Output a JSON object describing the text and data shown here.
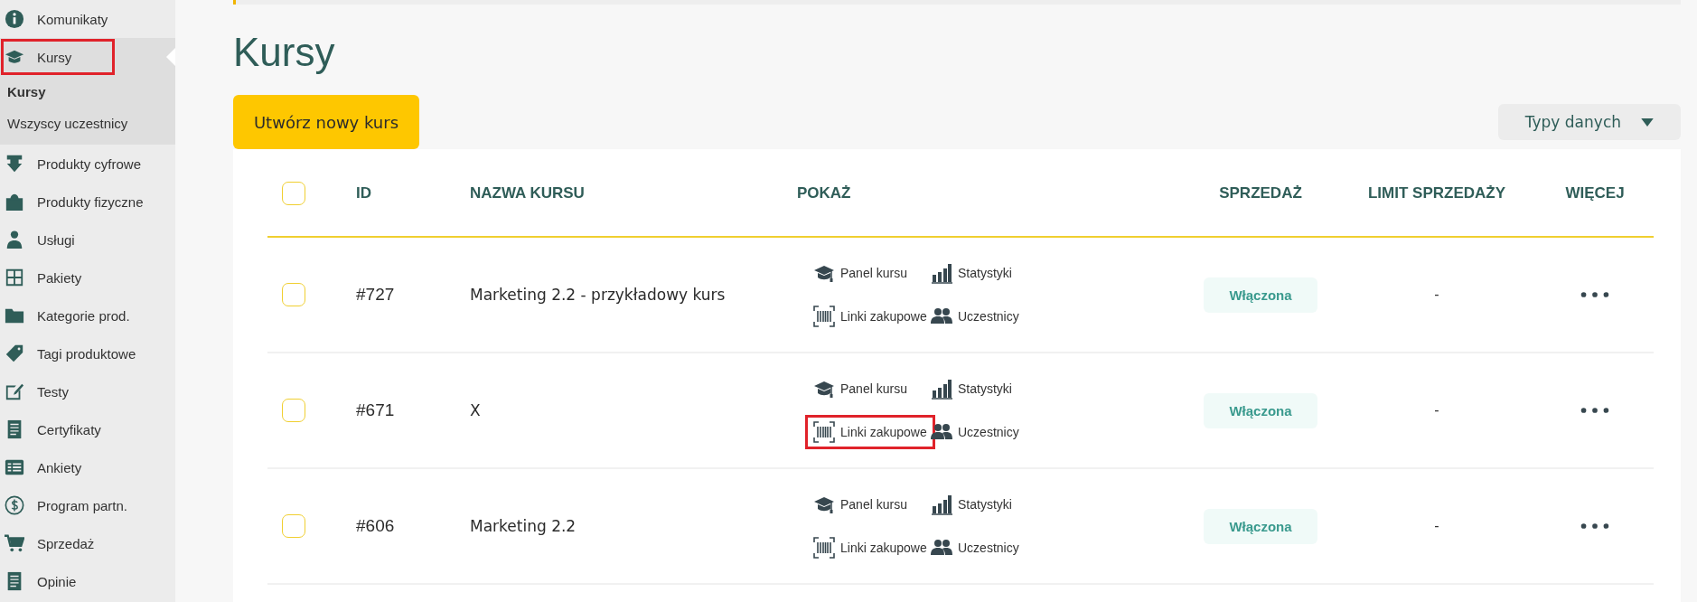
{
  "sidebar": {
    "items": [
      {
        "label": "Komunikaty",
        "selected": false,
        "highlighted": false
      },
      {
        "label": "Kursy",
        "selected": true,
        "highlighted": true,
        "children": [
          {
            "label": "Kursy",
            "selected": true
          },
          {
            "label": "Wszyscy uczestnicy",
            "selected": false
          }
        ]
      },
      {
        "label": "Produkty cyfrowe",
        "selected": false,
        "highlighted": false
      },
      {
        "label": "Produkty fizyczne",
        "selected": false,
        "highlighted": false
      },
      {
        "label": "Usługi",
        "selected": false,
        "highlighted": false
      },
      {
        "label": "Pakiety",
        "selected": false,
        "highlighted": false
      },
      {
        "label": "Kategorie prod.",
        "selected": false,
        "highlighted": false
      },
      {
        "label": "Tagi produktowe",
        "selected": false,
        "highlighted": false
      },
      {
        "label": "Testy",
        "selected": false,
        "highlighted": false
      },
      {
        "label": "Certyfikaty",
        "selected": false,
        "highlighted": false
      },
      {
        "label": "Ankiety",
        "selected": false,
        "highlighted": false
      },
      {
        "label": "Program partn.",
        "selected": false,
        "highlighted": false
      },
      {
        "label": "Sprzedaż",
        "selected": false,
        "highlighted": false
      },
      {
        "label": "Opinie",
        "selected": false,
        "highlighted": false
      }
    ]
  },
  "page": {
    "title": "Kursy",
    "create_button": "Utwórz nowy kurs",
    "data_types_button": "Typy danych"
  },
  "table": {
    "columns": [
      "ID",
      "NAZWA KURSU",
      "POKAŻ",
      "SPRZEDAŻ",
      "LIMIT SPRZEDAŻY",
      "WIĘCEJ"
    ],
    "header_checked": false,
    "rows": [
      {
        "checked": false,
        "id": "#727",
        "name": "Marketing 2.2 - przykładowy kurs",
        "actions": [
          {
            "label": "Panel kursu",
            "highlighted": false
          },
          {
            "label": "Statystyki",
            "highlighted": false
          },
          {
            "label": "Linki zakupowe",
            "highlighted": false
          },
          {
            "label": "Uczestnicy",
            "highlighted": false
          }
        ],
        "sales": "Włączona",
        "limit": "-"
      },
      {
        "checked": false,
        "id": "#671",
        "name": "X",
        "actions": [
          {
            "label": "Panel kursu",
            "highlighted": false
          },
          {
            "label": "Statystyki",
            "highlighted": false
          },
          {
            "label": "Linki zakupowe",
            "highlighted": true
          },
          {
            "label": "Uczestnicy",
            "highlighted": false
          }
        ],
        "sales": "Włączona",
        "limit": "-"
      },
      {
        "checked": false,
        "id": "#606",
        "name": "Marketing 2.2",
        "actions": [
          {
            "label": "Panel kursu",
            "highlighted": false
          },
          {
            "label": "Statystyki",
            "highlighted": false
          },
          {
            "label": "Linki zakupowe",
            "highlighted": false
          },
          {
            "label": "Uczestnicy",
            "highlighted": false
          }
        ],
        "sales": "Włączona",
        "limit": "-"
      }
    ]
  }
}
